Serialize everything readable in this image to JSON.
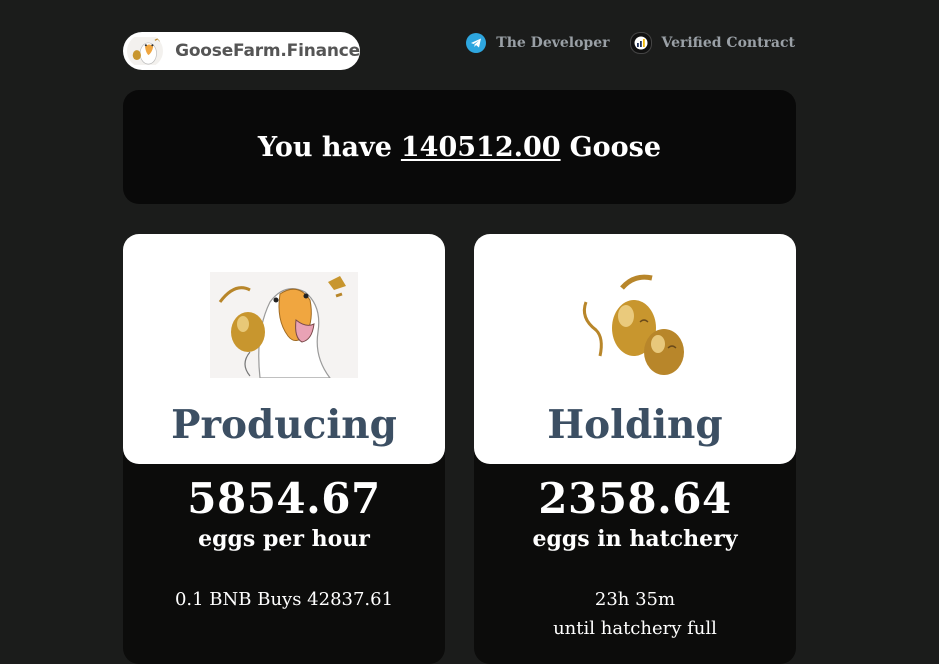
{
  "header": {
    "logo_text": "GooseFarm.Finance",
    "links": [
      {
        "label": "The Developer",
        "icon": "telegram-icon"
      },
      {
        "label": "Verified Contract",
        "icon": "bscscan-icon"
      }
    ]
  },
  "balance": {
    "prefix": "You have",
    "amount": "140512.00",
    "suffix": "Goose"
  },
  "cards": [
    {
      "title": "Producing",
      "value": "5854.67",
      "label": "eggs per hour",
      "detail": "0.1 BNB Buys 42837.61",
      "detail2": ""
    },
    {
      "title": "Holding",
      "value": "2358.64",
      "label": "eggs in hatchery",
      "detail": "23h 35m",
      "detail2": "until hatchery full"
    }
  ],
  "colors": {
    "background": "#1b1c1b",
    "panel": "#0c0c0b",
    "card_title": "#3c4f63",
    "link_text": "#9aa0a6",
    "telegram_blue": "#2ea6df",
    "gold": "#c8962e"
  }
}
